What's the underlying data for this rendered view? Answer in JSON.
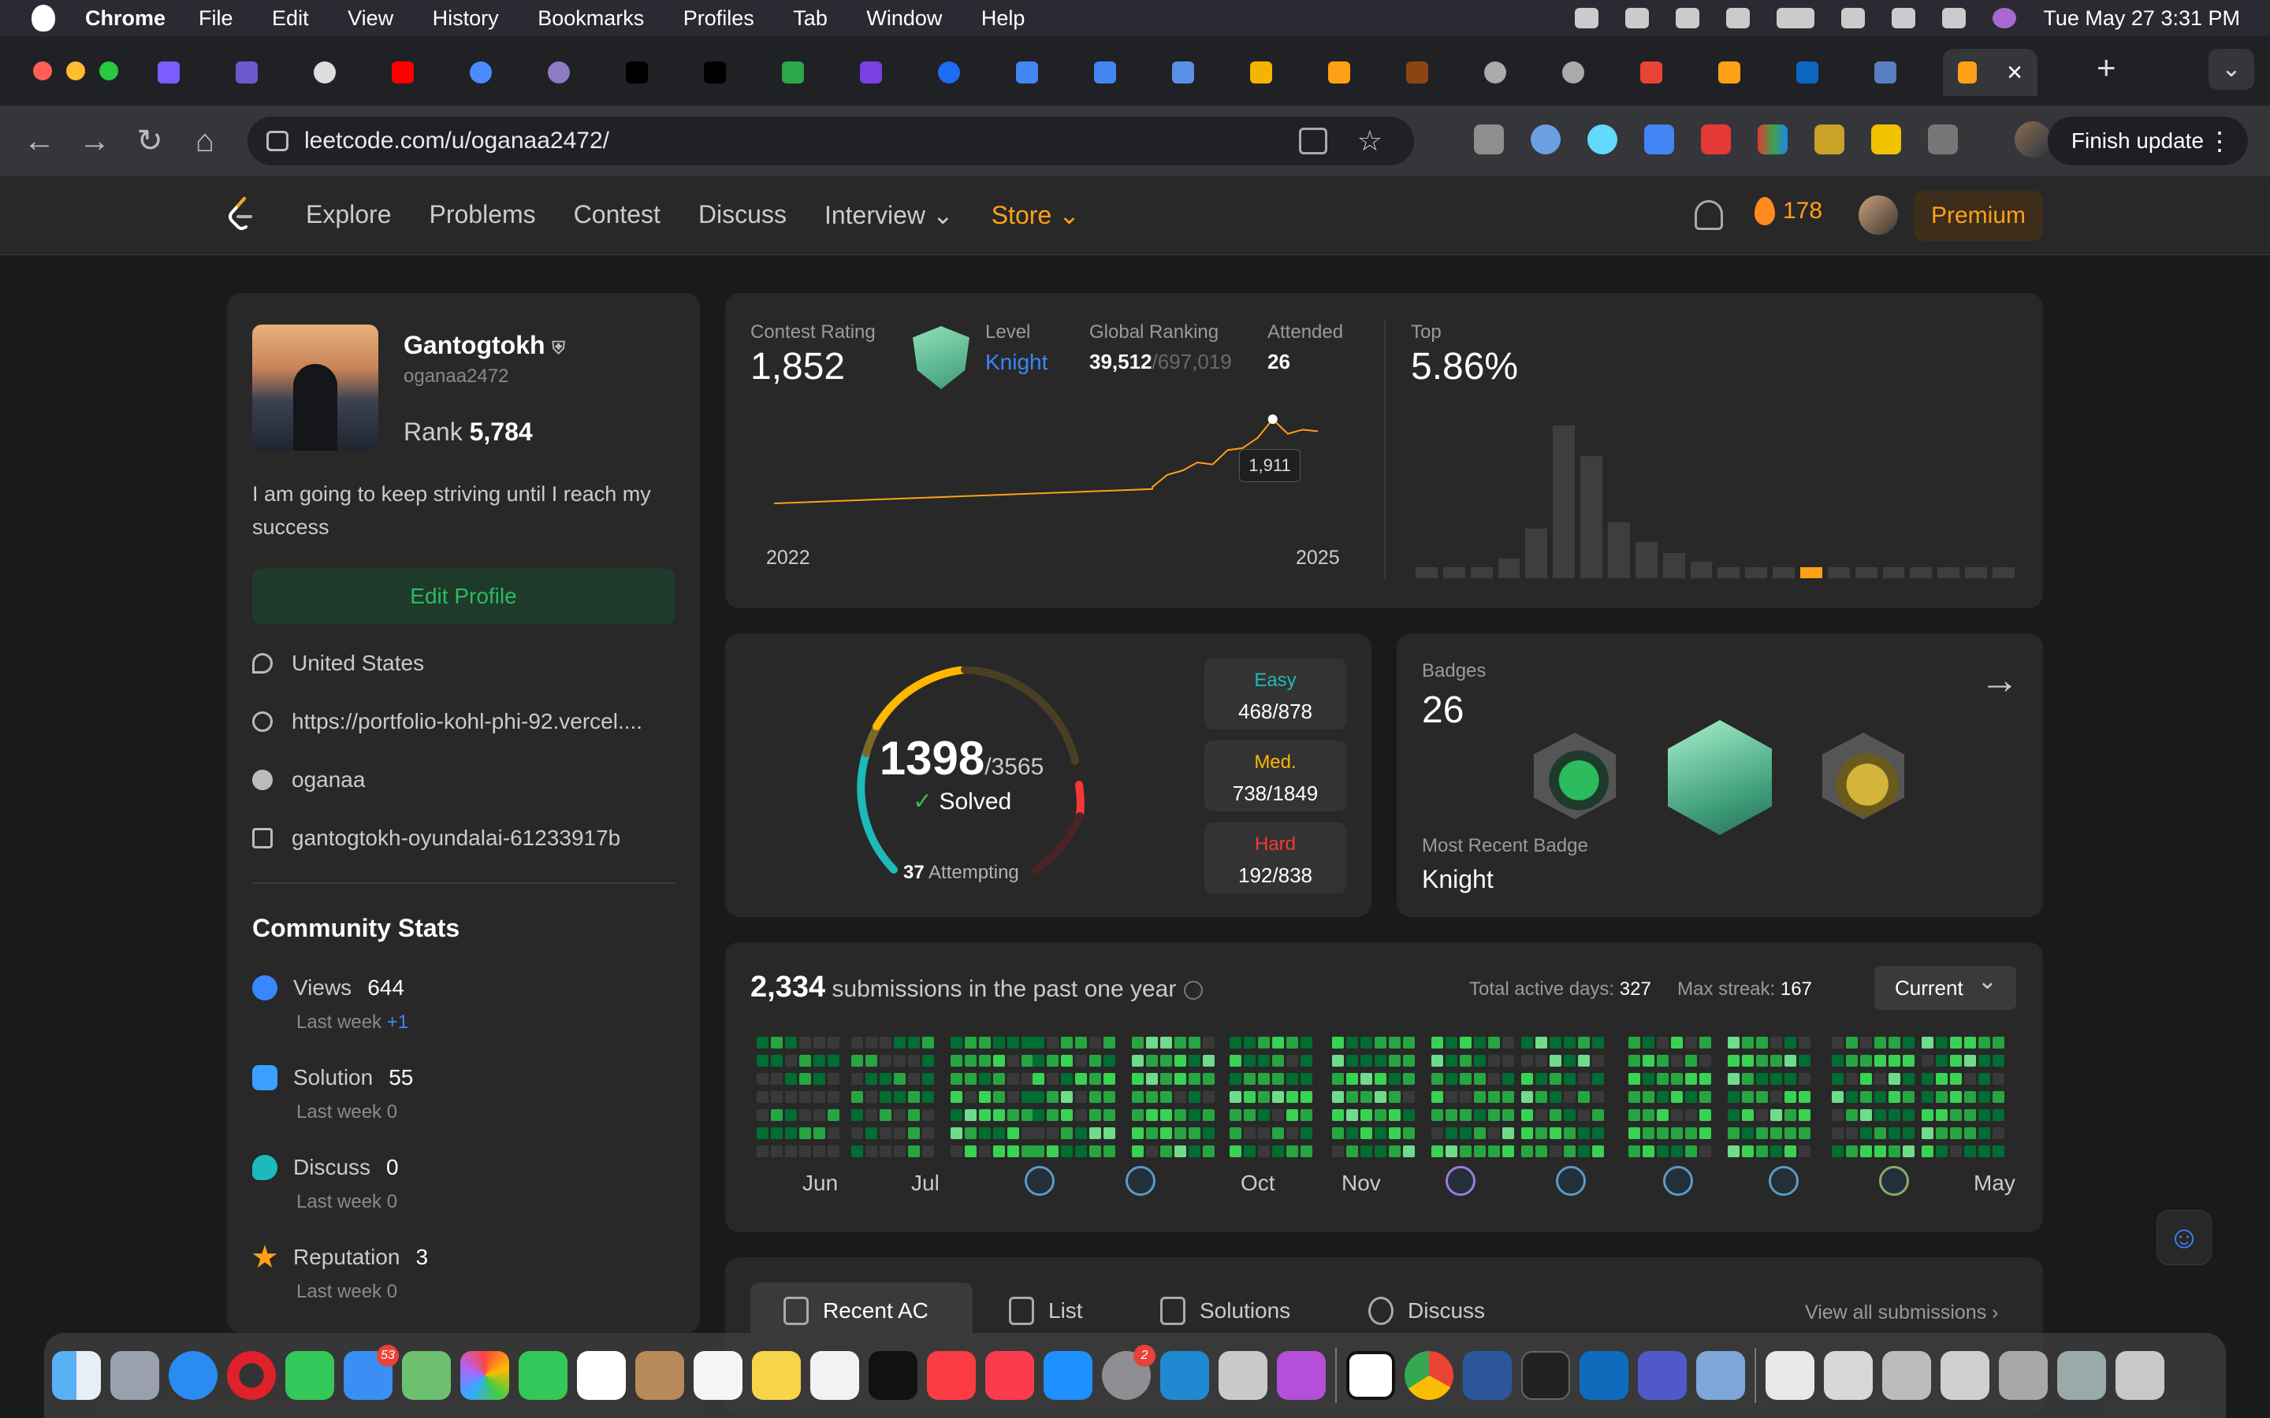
{
  "menubar": {
    "app": "Chrome",
    "menus": [
      "File",
      "Edit",
      "View",
      "History",
      "Bookmarks",
      "Profiles",
      "Tab",
      "Window",
      "Help"
    ],
    "clock": "Tue May 27  3:31 PM"
  },
  "browser": {
    "url": "leetcode.com/u/oganaa2472/",
    "finish_update": "Finish update"
  },
  "lc_nav": {
    "links": [
      "Explore",
      "Problems",
      "Contest",
      "Discuss",
      "Interview ⌄"
    ],
    "store": "Store ⌄",
    "streak": "178",
    "premium": "Premium"
  },
  "profile": {
    "name": "Gantogtokh",
    "username": "oganaa2472",
    "rank_label": "Rank",
    "rank_value": "5,784",
    "bio": "I am going to keep striving until I reach my success",
    "edit_button": "Edit Profile",
    "location": "United States",
    "website": "https://portfolio-kohl-phi-92.vercel....",
    "github": "oganaa",
    "linkedin": "gantogtokh-oyundalai-61233917b"
  },
  "community": {
    "title": "Community Stats",
    "views": {
      "label": "Views",
      "value": "644",
      "sub": "Last week",
      "delta": "+1"
    },
    "solution": {
      "label": "Solution",
      "value": "55",
      "sub": "Last week",
      "delta": "0"
    },
    "discuss": {
      "label": "Discuss",
      "value": "0",
      "sub": "Last week",
      "delta": "0"
    },
    "reputation": {
      "label": "Reputation",
      "value": "3",
      "sub": "Last week",
      "delta": "0"
    }
  },
  "contest": {
    "rating_label": "Contest Rating",
    "rating": "1,852",
    "level_label": "Level",
    "level": "Knight",
    "global_label": "Global Ranking",
    "global_rank": "39,512",
    "global_total": "/697,019",
    "attended_label": "Attended",
    "attended": "26",
    "top_label": "Top",
    "top": "5.86%",
    "tooltip": "1,911",
    "x_start": "2022",
    "x_end": "2025"
  },
  "solved": {
    "count": "1398",
    "total": "/3565",
    "label": "Solved",
    "attempting_count": "37",
    "attempting_label": "Attempting",
    "easy_label": "Easy",
    "easy": "468/878",
    "med_label": "Med.",
    "med": "738/1849",
    "hard_label": "Hard",
    "hard": "192/838"
  },
  "badges": {
    "title": "Badges",
    "count": "26",
    "recent_label": "Most Recent Badge",
    "recent": "Knight"
  },
  "submissions": {
    "count": "2,334",
    "text": "submissions in the past one year",
    "active_label": "Total active days:",
    "active": "327",
    "streak_label": "Max streak:",
    "streak": "167",
    "select": "Current",
    "months": [
      "Jun",
      "Jul",
      "Oct",
      "Nov",
      "May"
    ]
  },
  "recent_tabs": {
    "tabs": [
      "Recent AC",
      "List",
      "Solutions",
      "Discuss"
    ],
    "view_all": "View all submissions"
  },
  "chart_data": [
    {
      "type": "line",
      "title": "Contest Rating",
      "x": [
        "2022",
        "2025"
      ],
      "y_points": [
        1500,
        1505,
        1510,
        1515,
        1520,
        1525,
        1530,
        1535,
        1540,
        1545,
        1550,
        1555,
        1560,
        1565,
        1570,
        1580,
        1640,
        1660,
        1700,
        1690,
        1760,
        1770,
        1820,
        1911,
        1840,
        1860,
        1852
      ],
      "highlight": {
        "value": 1911
      }
    },
    {
      "type": "bar",
      "title": "Top",
      "values": [
        4,
        4,
        4,
        7,
        18,
        55,
        44,
        20,
        13,
        9,
        6,
        4,
        4,
        4,
        4,
        4,
        4,
        4,
        4,
        4,
        4,
        4
      ],
      "highlight_index": 14,
      "accent": "#ffa116"
    }
  ],
  "colors": {
    "accent": "#ffa116",
    "easy": "#1cbaba",
    "medium": "#ffb700",
    "hard": "#f63737",
    "green": "#2cbb5d"
  }
}
